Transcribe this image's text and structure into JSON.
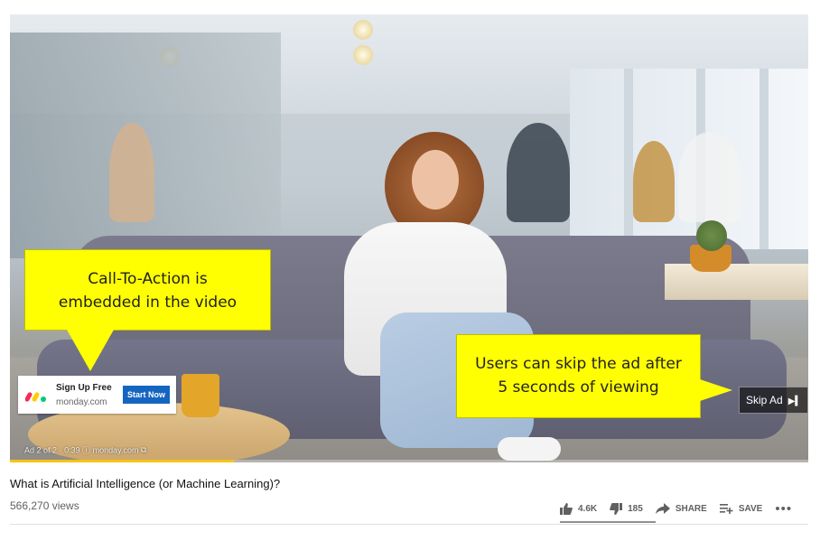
{
  "ad": {
    "title": "Sign Up Free",
    "domain": "monday.com",
    "cta": "Start Now",
    "meta_position": "Ad 2 of 2",
    "meta_time": "0:39",
    "meta_domain": "monday.com",
    "skip_label": "Skip Ad",
    "progress": 0.28
  },
  "annotations": {
    "cta_callout": [
      "Call-To-Action is",
      "embedded in the video"
    ],
    "skip_callout": [
      "Users can skip the ad after",
      "5 seconds of viewing"
    ]
  },
  "video": {
    "title": "What is Artificial Intelligence (or Machine Learning)?",
    "views": "566,270 views"
  },
  "actions": {
    "likes": "4.6K",
    "dislikes": "185",
    "share": "SHARE",
    "save": "SAVE",
    "more": "•••"
  },
  "colors": {
    "callout": "#ffff02",
    "cta_button": "#1565c0",
    "ad_progress": "#f6c418"
  }
}
